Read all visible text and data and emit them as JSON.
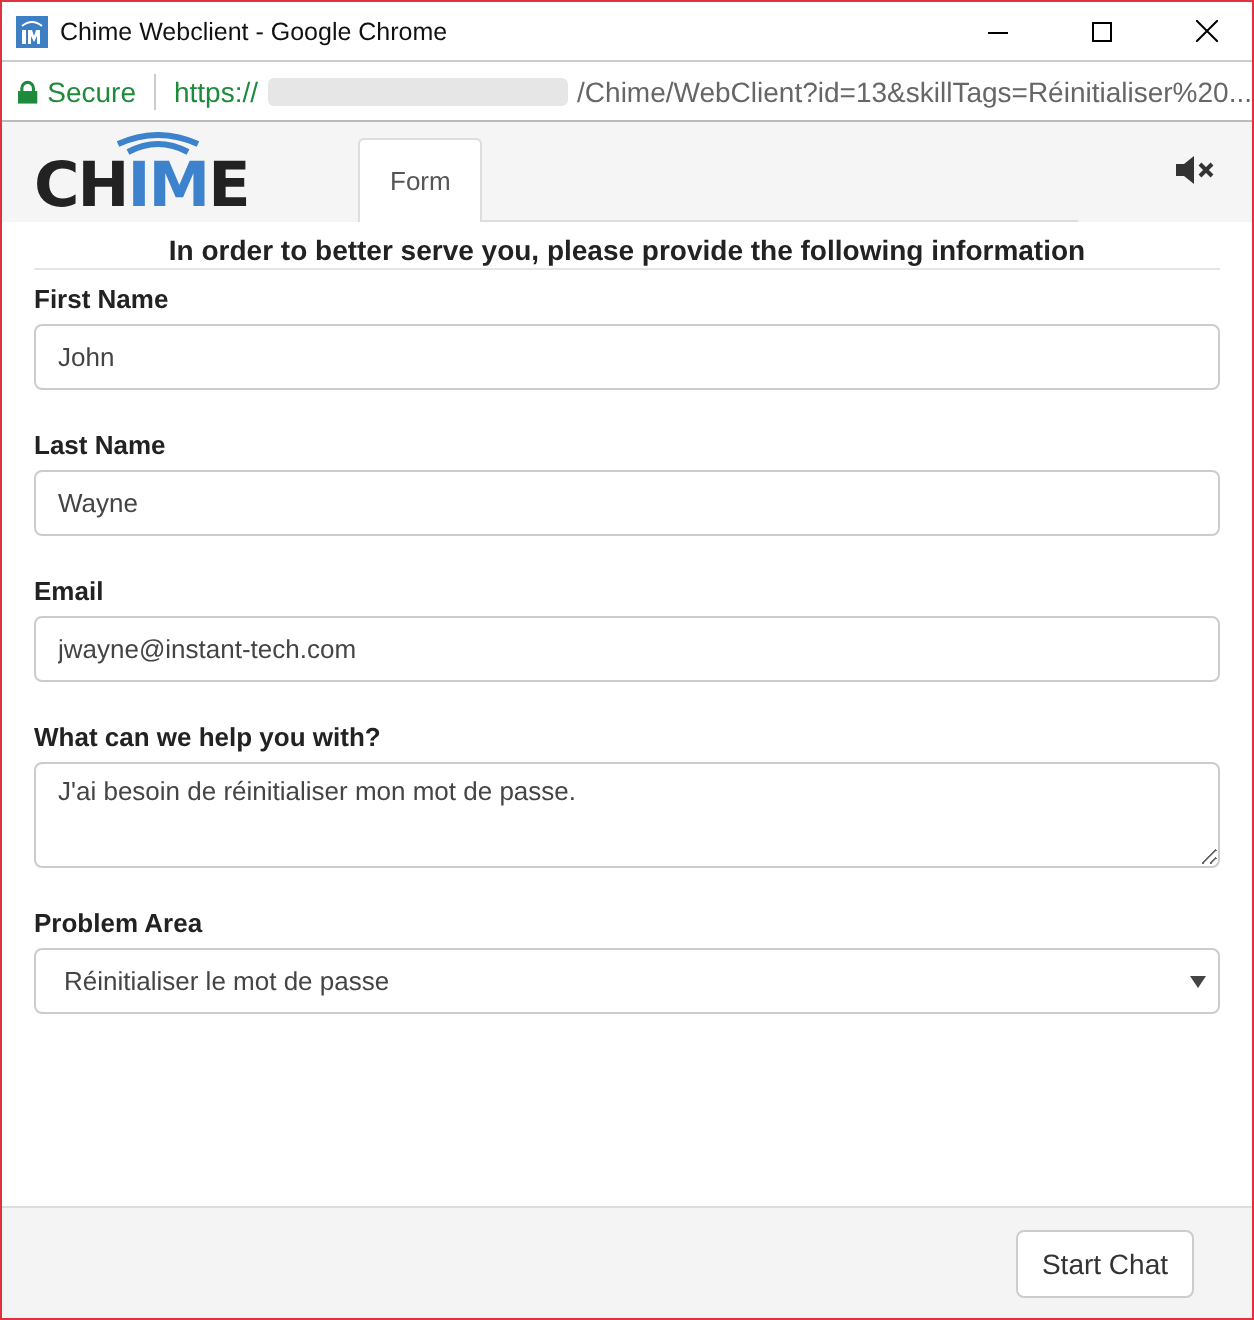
{
  "window": {
    "title": "Chime Webclient - Google Chrome"
  },
  "address_bar": {
    "secure_label": "Secure",
    "url_start": "https://",
    "url_end": "/Chime/WebClient?id=13&skillTags=Réinitialiser%20..."
  },
  "header": {
    "logo_parts": [
      "CH",
      "IM",
      "E"
    ],
    "tabs": [
      {
        "label": "Form",
        "selected": true
      }
    ],
    "muted": true
  },
  "form": {
    "heading": "In order to better serve you, please provide the following information",
    "fields": [
      {
        "kind": "text",
        "label": "First Name",
        "value": "John"
      },
      {
        "kind": "text",
        "label": "Last Name",
        "value": "Wayne"
      },
      {
        "kind": "text",
        "label": "Email",
        "value": "jwayne@instant-tech.com"
      },
      {
        "kind": "textarea",
        "label": "What can we help you with?",
        "value": "J'ai besoin de réinitialiser mon mot de passe."
      },
      {
        "kind": "select",
        "label": "Problem Area",
        "value": "Réinitialiser le mot de passe"
      }
    ]
  },
  "footer": {
    "button": "Start Chat"
  }
}
